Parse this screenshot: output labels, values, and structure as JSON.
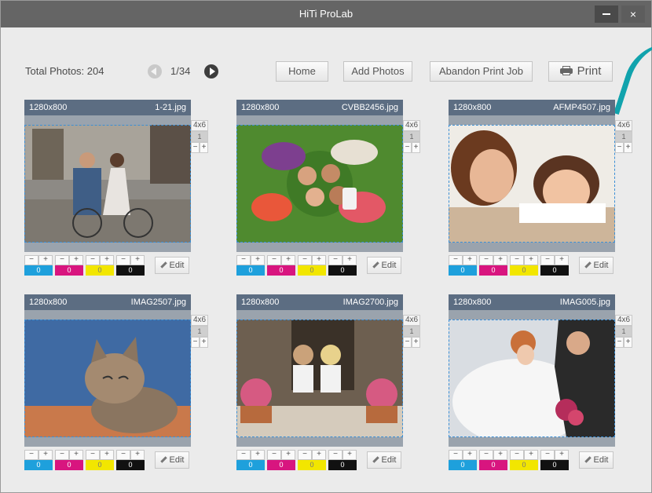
{
  "window": {
    "title": "HiTi ProLab",
    "minimize": "—",
    "close": "×"
  },
  "toolbar": {
    "total_photos": "Total Photos: 204",
    "page_indicator": "1/34",
    "home": "Home",
    "add_photos": "Add Photos",
    "abandon": "Abandon Print Job",
    "print": "Print"
  },
  "colors": {
    "cyan": "#1ea0dc",
    "magenta": "#d8157f",
    "yellow": "#f2e600",
    "black": "#111111",
    "header": "#5c6d82",
    "accent": "#11a3ad"
  },
  "cards": [
    {
      "resolution": "1280x800",
      "filename": "1-21.jpg",
      "size": "4x6",
      "qty": "1",
      "minus": "−",
      "plus": "+",
      "edit": "Edit",
      "inks": [
        "0",
        "0",
        "0",
        "0"
      ],
      "photo": "wedding-couple-bicycle"
    },
    {
      "resolution": "1280x800",
      "filename": "CVBB2456.jpg",
      "size": "4x6",
      "qty": "1",
      "minus": "−",
      "plus": "+",
      "edit": "Edit",
      "inks": [
        "0",
        "0",
        "0",
        "0"
      ],
      "photo": "friends-on-grass"
    },
    {
      "resolution": "1280x800",
      "filename": "AFMP4507.jpg",
      "size": "4x6",
      "qty": "1",
      "minus": "−",
      "plus": "+",
      "edit": "Edit",
      "inks": [
        "0",
        "0",
        "0",
        "0"
      ],
      "photo": "mother-and-child"
    },
    {
      "resolution": "1280x800",
      "filename": "IMAG2507.jpg",
      "size": "4x6",
      "qty": "1",
      "minus": "−",
      "plus": "+",
      "edit": "Edit",
      "inks": [
        "0",
        "0",
        "0",
        "0"
      ],
      "photo": "kitten"
    },
    {
      "resolution": "1280x800",
      "filename": "IMAG2700.jpg",
      "size": "4x6",
      "qty": "1",
      "minus": "−",
      "plus": "+",
      "edit": "Edit",
      "inks": [
        "0",
        "0",
        "0",
        "0"
      ],
      "photo": "two-girls-porch"
    },
    {
      "resolution": "1280x800",
      "filename": "IMAG005.jpg",
      "size": "4x6",
      "qty": "1",
      "minus": "−",
      "plus": "+",
      "edit": "Edit",
      "inks": [
        "0",
        "0",
        "0",
        "0"
      ],
      "photo": "bride-and-groom"
    }
  ]
}
